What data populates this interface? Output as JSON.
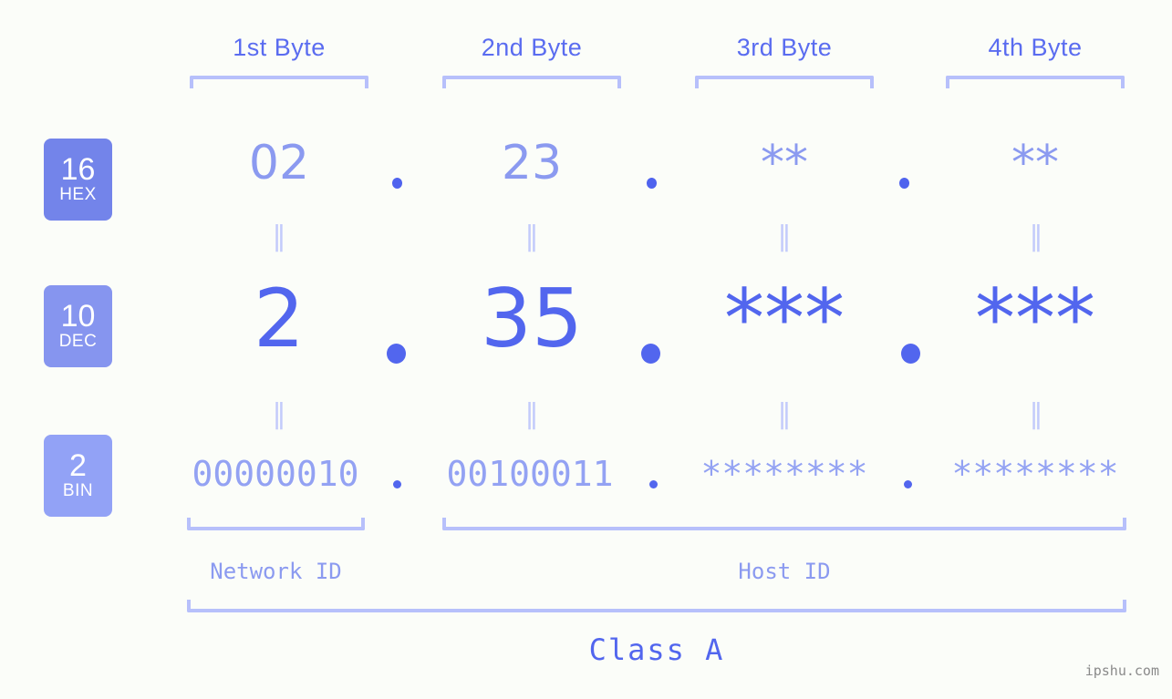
{
  "meta": {
    "background_color": "#fbfdf9",
    "accent_strong": "#5266ee",
    "accent_mid": "#8b9af0",
    "accent_light": "#b7c0fb",
    "watermark": "ipshu.com"
  },
  "byte_headers": [
    {
      "label": "1st Byte"
    },
    {
      "label": "2nd Byte"
    },
    {
      "label": "3rd Byte"
    },
    {
      "label": "4th Byte"
    }
  ],
  "bases": [
    {
      "number": "16",
      "name": "HEX",
      "color": "#7384ea"
    },
    {
      "number": "10",
      "name": "DEC",
      "color": "#8695ef"
    },
    {
      "number": "2",
      "name": "BIN",
      "color": "#92a2f6"
    }
  ],
  "rows": {
    "hex": {
      "base_number": "16",
      "base_name": "HEX",
      "values": [
        "02",
        "23",
        "**",
        "**"
      ],
      "separator": "."
    },
    "dec": {
      "base_number": "10",
      "base_name": "DEC",
      "values": [
        "2",
        "35",
        "***",
        "***"
      ],
      "separator": "."
    },
    "bin": {
      "base_number": "2",
      "base_name": "BIN",
      "values": [
        "00000010",
        "00100011",
        "********",
        "********"
      ],
      "separator": "."
    }
  },
  "equals_symbol": "‖",
  "segments": {
    "network_id": "Network ID",
    "host_id": "Host ID"
  },
  "class_label": "Class A"
}
